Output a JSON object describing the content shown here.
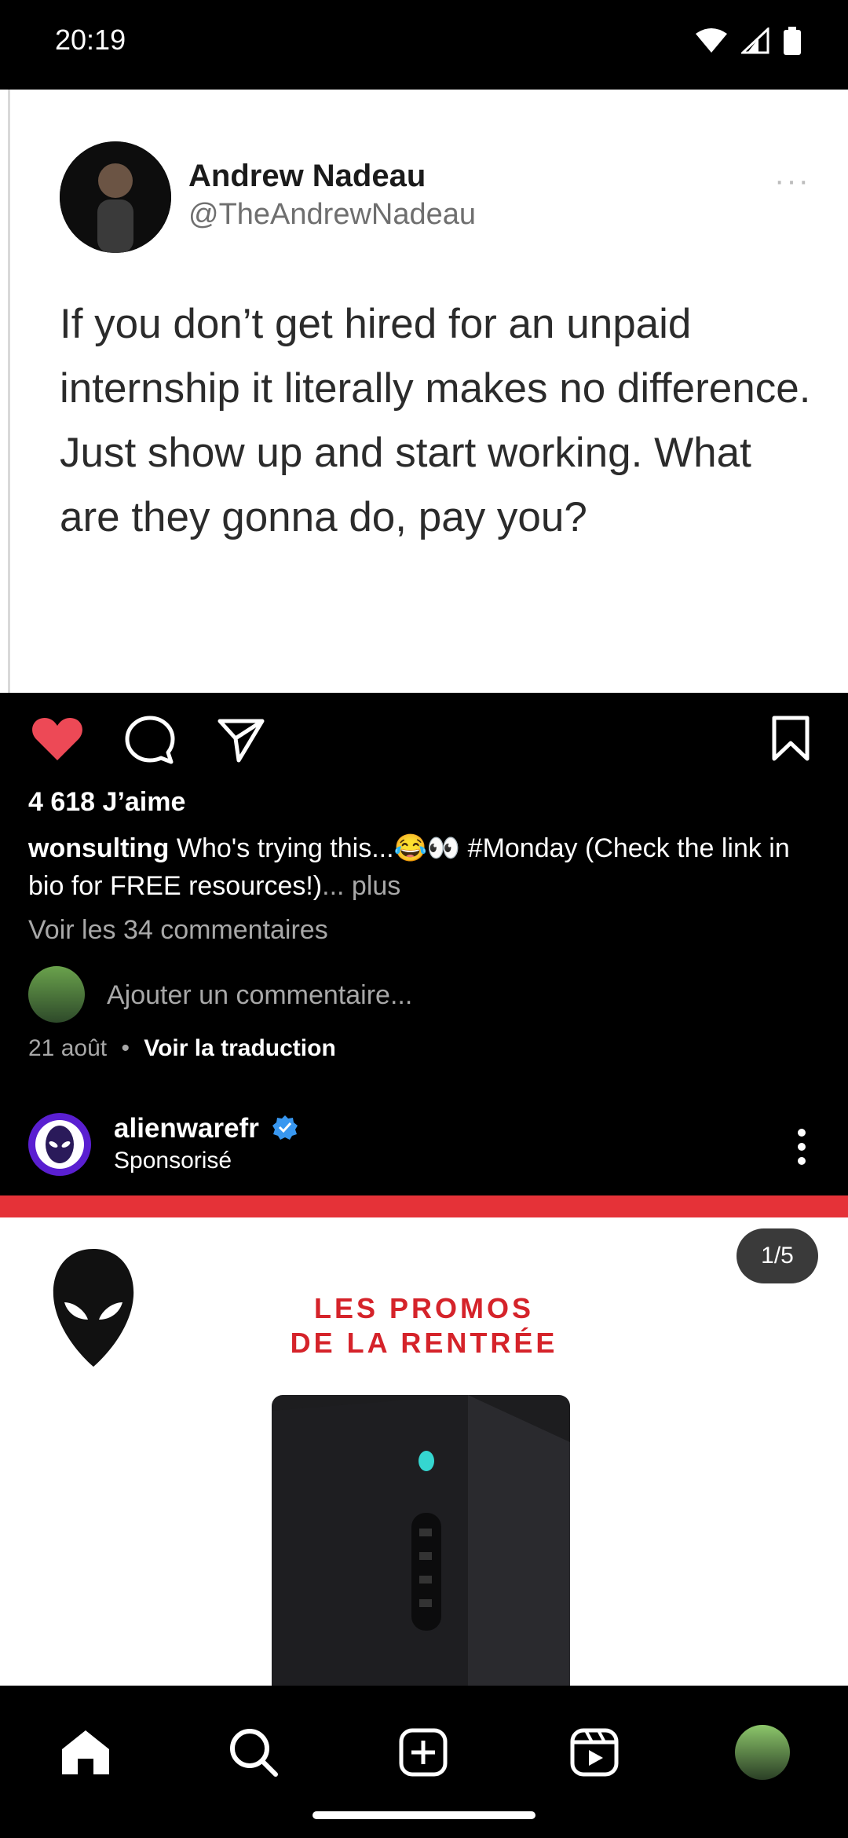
{
  "status_bar": {
    "time": "20:19"
  },
  "tweet": {
    "name": "Andrew Nadeau",
    "handle": "@TheAndrewNadeau",
    "more": "···",
    "text": "If you don’t get hired for an unpaid internship it literally makes no difference. Just show up and start working. What are they gonna do, pay you?"
  },
  "post": {
    "likes": "4 618 J’aime",
    "caption_user": "wonsulting",
    "caption_text": " Who's trying this...😂👀 #Monday (Check the link in bio for FREE resources!)",
    "caption_more": "... plus",
    "comments_link": "Voir les 34 commentaires",
    "add_comment_placeholder": "Ajouter un commentaire...",
    "date": "21 août",
    "dot": "•",
    "translate": "Voir la traduction"
  },
  "sponsored": {
    "account": "alienwarefr",
    "label": "Sponsorisé"
  },
  "ad": {
    "counter": "1/5",
    "headline_line1": "LES PROMOS",
    "headline_line2": "DE LA RENTRÉE"
  },
  "icons": {
    "like": "heart-icon",
    "comment": "comment-icon",
    "share": "send-icon",
    "save": "bookmark-icon",
    "home": "home-icon",
    "search": "search-icon",
    "create": "plus-square-icon",
    "reels": "reels-icon"
  },
  "colors": {
    "like_red": "#ed4956",
    "ad_red": "#e53238",
    "verified_blue": "#3897f0"
  }
}
